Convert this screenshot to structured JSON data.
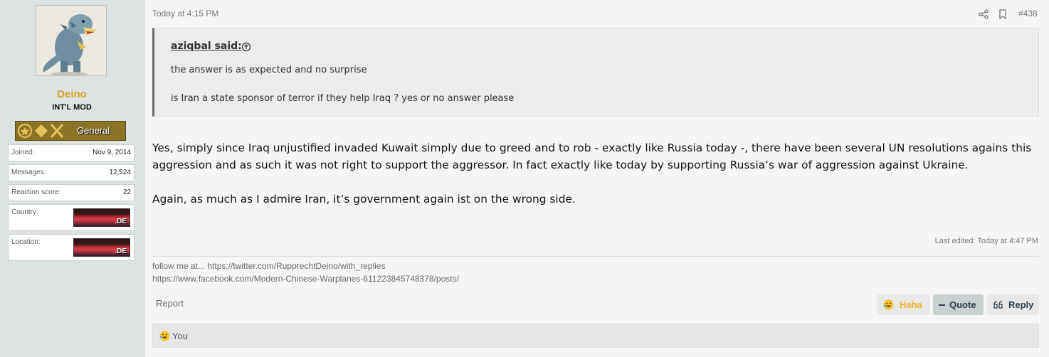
{
  "user": {
    "name": "Deino",
    "title": "INT'L MOD",
    "rank": "General",
    "avatar_icon": "dinosaur-avatar",
    "stats": [
      {
        "key": "Joined:",
        "value": "Nov 9, 2014"
      },
      {
        "key": "Messages:",
        "value": "12,524"
      },
      {
        "key": "Reaction score:",
        "value": "22"
      }
    ],
    "country": {
      "label": "Country:",
      "flag_text": ".DE"
    },
    "location": {
      "label": "Location:",
      "flag_text": ".DE"
    }
  },
  "post": {
    "timestamp": "Today at 4:15 PM",
    "number": "#438",
    "quote": {
      "author": "aziqbal said:",
      "lines": [
        "the answer is as expected and no surprise",
        "is Iran a state sponsor of terror if they help Iraq ? yes or no answer please"
      ]
    },
    "body": [
      "Yes, simply since Iraq unjustified invaded Kuwait simply due to greed and to rob - exactly like Russia today -, there have been several UN resolutions agains this",
      "aggression and as such it was not right to support the aggressor. In fact exactly like today by supporting Russia‘s war of aggression against Ukraine.",
      "Again, as much as I admire Iran, it’s government again ist on the wrong side."
    ],
    "last_edited": "Last edited: Today at 4:47 PM",
    "signature": [
      "follow me at... https://twitter.com/RupprechtDeino/with_replies",
      "https://www.facebook.com/Modern-Chinese-Warplanes-611223845748378/posts/"
    ]
  },
  "actions": {
    "report": "Report",
    "haha": "Haha",
    "quote": "Quote",
    "reply": "Reply"
  },
  "reactions": {
    "text": "You"
  },
  "colors": {
    "username": "#d9a22a",
    "haha": "#f0b429",
    "sidebar_bg": "#dde3e3"
  }
}
